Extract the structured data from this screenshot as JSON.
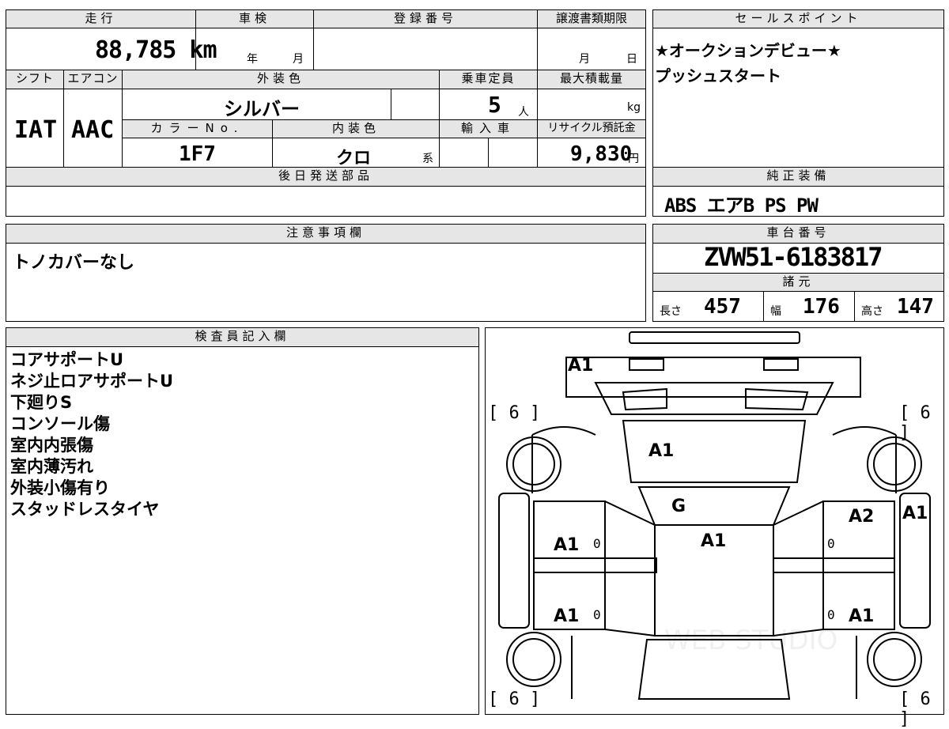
{
  "top": {
    "mileage_header": "走行",
    "mileage": "88,785 km",
    "shaken_header": "車検",
    "shaken_year": "年",
    "shaken_month": "月",
    "reg_header": "登録番号",
    "transfer_header": "譲渡書類期限",
    "transfer_month": "月",
    "transfer_day": "日",
    "shift_header": "シフト",
    "shift": "IAT",
    "ac_header": "エアコン",
    "ac": "AAC",
    "exterior_header": "外装色",
    "exterior": "シルバー",
    "capacity_header": "乗車定員",
    "capacity": "5",
    "capacity_unit": "人",
    "maxload_header": "最大積載量",
    "maxload_unit": "kg",
    "colorno_header": "カラーNo.",
    "colorno": "1F7",
    "interior_header": "内装色",
    "interior": "クロ",
    "interior_suffix": "系",
    "import_header": "輸入車",
    "recycle_header": "リサイクル預託金",
    "recycle": "9,830",
    "recycle_unit": "円",
    "later_parts_header": "後日発送部品"
  },
  "sales": {
    "header": "セールスポイント",
    "lines": [
      "★オークションデビュー★",
      "プッシュスタート"
    ]
  },
  "equipment": {
    "header": "純正装備",
    "value": "ABS エアB PS PW"
  },
  "caution": {
    "header": "注意事項欄",
    "value": "トノカバーなし"
  },
  "chassis": {
    "header": "車台番号",
    "value": "ZVW51-6183817"
  },
  "specs": {
    "header": "諸元",
    "length_label": "長さ",
    "length": "457",
    "width_label": "幅",
    "width": "176",
    "height_label": "高さ",
    "height": "147"
  },
  "inspector": {
    "header": "検査員記入欄",
    "lines": [
      "コアサポートU",
      "ネジ止ロアサポートU",
      "下廻りS",
      "コンソール傷",
      "室内内張傷",
      "室内薄汚れ",
      "外装小傷有り",
      "スタッドレスタイヤ"
    ]
  },
  "damage_map": {
    "labels": {
      "front_bumper": "A1",
      "hood": "A1",
      "windshield": "G",
      "roof": "A1",
      "right_front_fender": "A2",
      "right_side": "A1",
      "left_front_door": "A1",
      "left_rear_door": "A1",
      "right_rear_door": "A1"
    },
    "zeros": "0",
    "tires": "[ 6 ]",
    "watermark": "WEB STUDIO"
  }
}
